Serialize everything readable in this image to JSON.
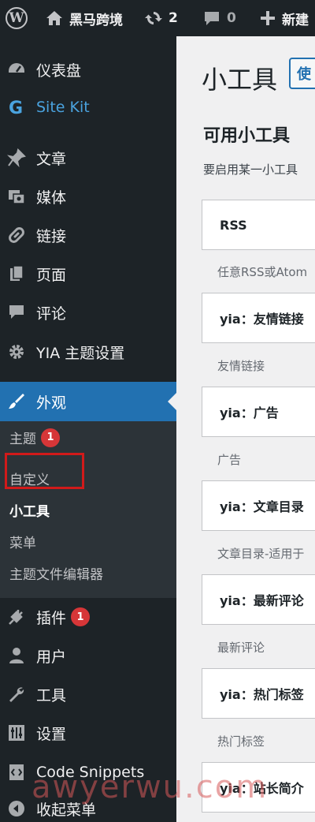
{
  "adminbar": {
    "wp_logo": "W",
    "site_name": "黑马跨境",
    "updates_count": "2",
    "comments_count": "0",
    "new_label": "新建"
  },
  "sidebar": {
    "items": [
      {
        "label": "仪表盘",
        "icon": "dashboard-icon"
      },
      {
        "label": "Site Kit",
        "icon": "sitekit-icon"
      },
      {
        "label": "文章",
        "icon": "pushpin-icon"
      },
      {
        "label": "媒体",
        "icon": "media-icon"
      },
      {
        "label": "链接",
        "icon": "link-icon"
      },
      {
        "label": "页面",
        "icon": "page-icon"
      },
      {
        "label": "评论",
        "icon": "comment-icon"
      },
      {
        "label": "YIA 主题设置",
        "icon": "gear-icon"
      },
      {
        "label": "外观",
        "icon": "brush-icon"
      },
      {
        "label": "插件",
        "icon": "plugin-icon",
        "badge": "1"
      },
      {
        "label": "用户",
        "icon": "user-icon"
      },
      {
        "label": "工具",
        "icon": "wrench-icon"
      },
      {
        "label": "设置",
        "icon": "settings-icon"
      },
      {
        "label": "Code Snippets",
        "icon": "code-icon"
      },
      {
        "label": "收起菜单",
        "icon": "collapse-icon"
      }
    ],
    "submenu": [
      {
        "label": "主题",
        "badge": "1"
      },
      {
        "label": "自定义"
      },
      {
        "label": "小工具"
      },
      {
        "label": "菜单"
      },
      {
        "label": "主题文件编辑器"
      }
    ]
  },
  "main": {
    "title": "小工具",
    "help_button": "使",
    "section_title": "可用小工具",
    "intro": "要启用某一小工具",
    "widgets": [
      {
        "name": "RSS",
        "desc": "任意RSS或Atom"
      },
      {
        "name": "yia：友情链接",
        "desc": "友情链接"
      },
      {
        "name": "yia：广告",
        "desc": "广告"
      },
      {
        "name": "yia：文章目录",
        "desc": "文章目录-适用于"
      },
      {
        "name": "yia：最新评论",
        "desc": "最新评论"
      },
      {
        "name": "yia：热门标签",
        "desc": "热门标签"
      },
      {
        "name": "yia：站长简介",
        "desc": ""
      }
    ]
  },
  "watermark": "awyerwu.com",
  "wechat_mark": "黑马跨境"
}
